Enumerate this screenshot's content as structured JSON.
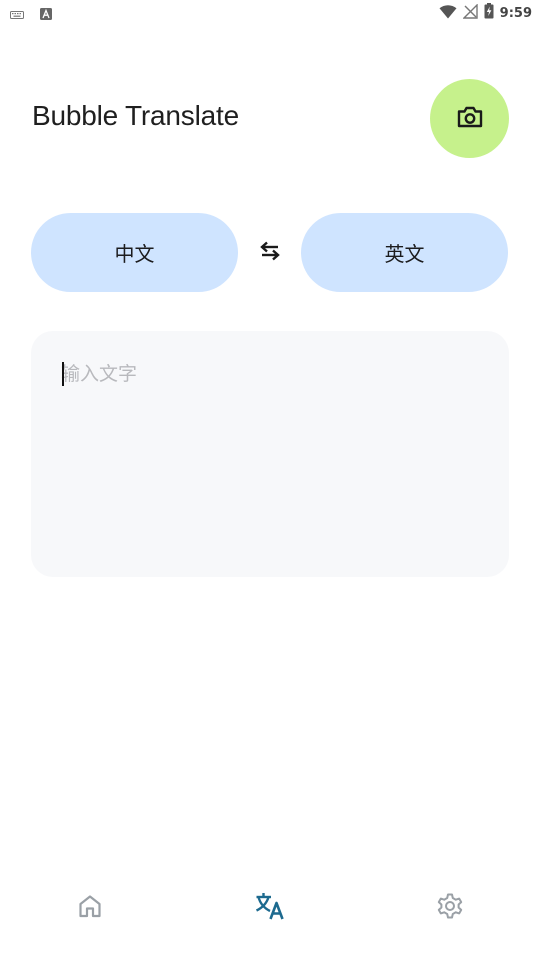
{
  "status_bar": {
    "time": "9:59",
    "left_icons": [
      "keyboard-icon",
      "font-a-icon"
    ],
    "right_icons": [
      "wifi-icon",
      "no-signal-icon",
      "battery-charging-icon"
    ]
  },
  "header": {
    "title": "Bubble Translate",
    "camera_button_icon": "camera-icon",
    "camera_button_color": "#c6f18c"
  },
  "language_selector": {
    "source_language": "中文",
    "target_language": "英文",
    "swap_icon": "swap-arrows-icon",
    "pill_color": "#cfe4ff"
  },
  "input": {
    "placeholder": "输入文字",
    "value": ""
  },
  "bottom_nav": {
    "items": [
      {
        "icon": "home-icon",
        "active": false
      },
      {
        "icon": "translate-icon",
        "active": true
      },
      {
        "icon": "settings-gear-icon",
        "active": false
      }
    ],
    "active_color": "#1d6a8f",
    "inactive_color": "#9aa0a6"
  }
}
